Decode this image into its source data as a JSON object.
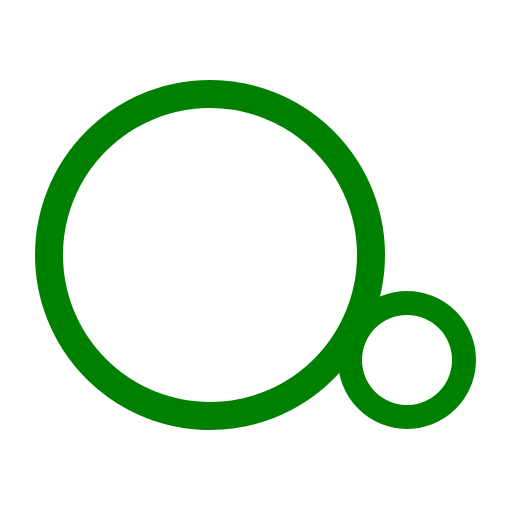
{
  "icon": {
    "name": "two-circles-icon",
    "stroke_color": "#008000",
    "fill_color": "#ffffff"
  }
}
